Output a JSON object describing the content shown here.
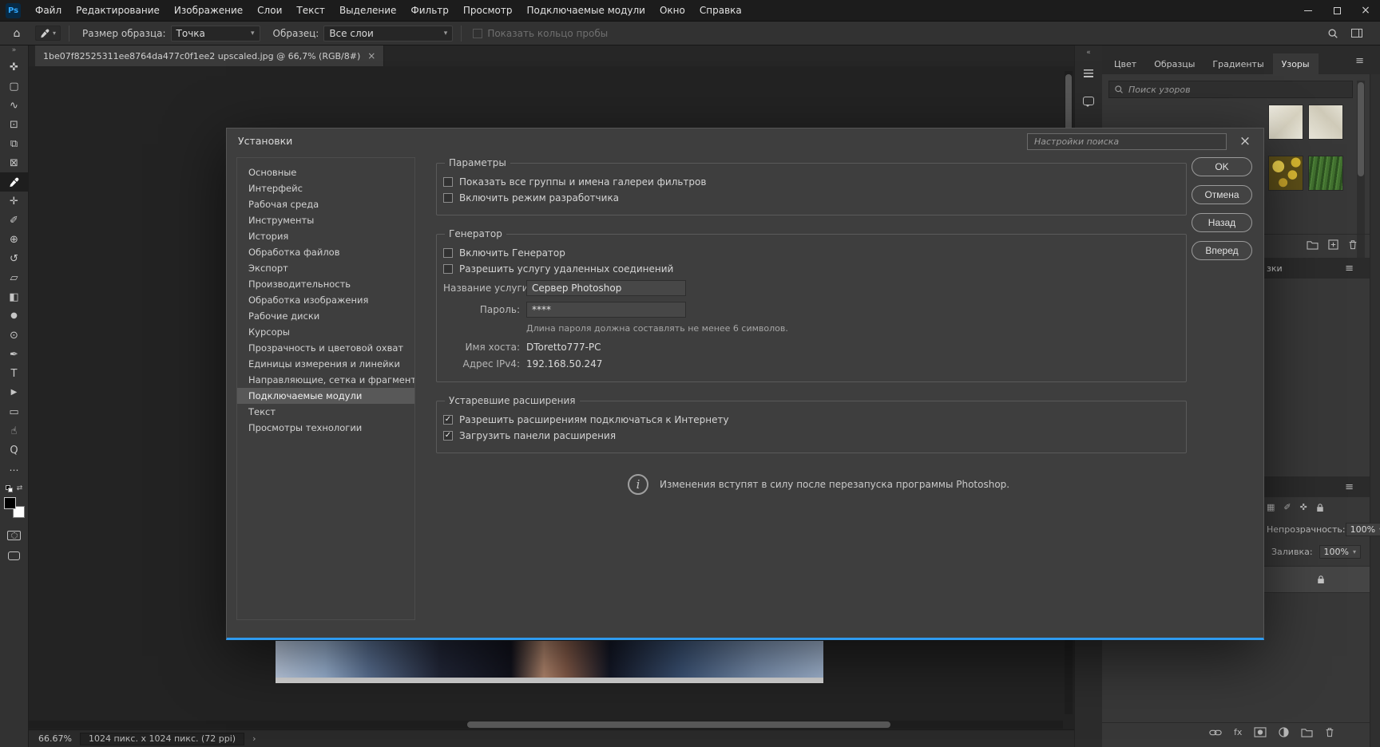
{
  "colors": {
    "accent_blue": "#1473e6",
    "dialog_bottom_line": "#2f9bf0",
    "ps_logo_blue": "#31a8ff",
    "panel_dark": "#2b2b2b",
    "dialog_bg": "#3e3e3e"
  },
  "glyphs": {
    "home": "⌂",
    "chevron_down": "▾",
    "collapse_left": "«",
    "collapse_right": "»",
    "ellipsis": "…",
    "menu": "≡",
    "close": "×",
    "close_small": "×",
    "caret_right": "›",
    "info": "i",
    "check": "✓",
    "swap": "⇄"
  },
  "menubar": {
    "logo": "Ps",
    "items": [
      "Файл",
      "Редактирование",
      "Изображение",
      "Слои",
      "Текст",
      "Выделение",
      "Фильтр",
      "Просмотр",
      "Подключаемые модули",
      "Окно",
      "Справка"
    ]
  },
  "optionsbar": {
    "sample_size_label": "Размер образца:",
    "sample_size_value": "Точка",
    "sample_label": "Образец:",
    "sample_value": "Все слои",
    "show_ring_label": "Показать кольцо пробы"
  },
  "document": {
    "tab_title": "1be07f82525311ee8764da477c0f1ee2 upscaled.jpg @ 66,7% (RGB/8#)"
  },
  "toolbar": {
    "tools": [
      {
        "name": "move",
        "glyph": "✜"
      },
      {
        "name": "marquee",
        "glyph": "▢"
      },
      {
        "name": "lasso",
        "glyph": "∿"
      },
      {
        "name": "object-selection",
        "glyph": "⊡"
      },
      {
        "name": "crop",
        "glyph": "⧉"
      },
      {
        "name": "frame",
        "glyph": "⊠"
      },
      {
        "name": "eyedropper",
        "glyph": ""
      },
      {
        "name": "healing-brush",
        "glyph": "✛"
      },
      {
        "name": "brush",
        "glyph": "✐"
      },
      {
        "name": "clone-stamp",
        "glyph": "⊕"
      },
      {
        "name": "history-brush",
        "glyph": "↺"
      },
      {
        "name": "eraser",
        "glyph": "▱"
      },
      {
        "name": "gradient",
        "glyph": "◧"
      },
      {
        "name": "blur",
        "glyph": "●"
      },
      {
        "name": "dodge",
        "glyph": "⊙"
      },
      {
        "name": "pen",
        "glyph": "✒"
      },
      {
        "name": "type",
        "glyph": "T"
      },
      {
        "name": "path-selection",
        "glyph": "▶"
      },
      {
        "name": "rectangle",
        "glyph": "▭"
      },
      {
        "name": "hand",
        "glyph": "☝"
      },
      {
        "name": "zoom",
        "glyph": "Q"
      }
    ]
  },
  "dialog": {
    "title": "Установки",
    "search_placeholder": "Настройки поиска",
    "sidebar": [
      "Основные",
      "Интерфейс",
      "Рабочая среда",
      "Инструменты",
      "История",
      "Обработка файлов",
      "Экспорт",
      "Производительность",
      "Обработка изображения",
      "Рабочие диски",
      "Курсоры",
      "Прозрачность и цветовой охват",
      "Единицы измерения и линейки",
      "Направляющие, сетка и фрагменты",
      "Подключаемые модули",
      "Текст",
      "Просмотры технологии"
    ],
    "selected_item": "Подключаемые модули",
    "groups": {
      "parameters": {
        "legend": "Параметры",
        "cb_show_groups": "Показать все группы и имена галереи фильтров",
        "cb_dev_mode": "Включить режим разработчика"
      },
      "generator": {
        "legend": "Генератор",
        "cb_enable": "Включить Генератор",
        "cb_remote": "Разрешить услугу удаленных соединений",
        "service_label": "Название услуги:",
        "service_value": "Сервер Photoshop",
        "password_label": "Пароль:",
        "password_value": "****",
        "password_note": "Длина пароля должна составлять не менее 6 символов.",
        "host_label": "Имя хоста:",
        "host_value": "DToretto777-PC",
        "ip_label": "Адрес IPv4:",
        "ip_value": "192.168.50.247"
      },
      "legacy": {
        "legend": "Устаревшие расширения",
        "cb_internet": "Разрешить расширениям подключаться к Интернету",
        "cb_panels": "Загрузить панели расширения"
      }
    },
    "info_note": "Изменения вступят в силу после перезапуска программы Photoshop.",
    "buttons": {
      "ok": "OK",
      "cancel": "Отмена",
      "back": "Назад",
      "forward": "Вперед"
    }
  },
  "right_panel": {
    "tabs": [
      "Цвет",
      "Образцы",
      "Градиенты",
      "Узоры"
    ],
    "active_tab": "Узоры",
    "search_placeholder": "Поиск узоров",
    "panel2_tab_fragment": "зки",
    "fx_label": "fx",
    "lock_glyphs": [
      "▦",
      "✐",
      "✜"
    ],
    "layers": {
      "opacity_label": "Непрозрачность:",
      "opacity_value": "100%",
      "fill_label": "Заливка:",
      "fill_value": "100%"
    }
  },
  "statusbar": {
    "zoom": "66.67%",
    "doc_info": "1024 пикс. x 1024 пикс. (72 ppi)"
  }
}
